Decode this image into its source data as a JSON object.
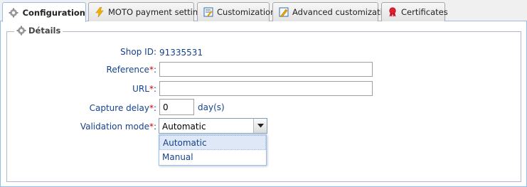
{
  "tabs": [
    {
      "label": "Configuration",
      "icon": "gear-icon",
      "active": true
    },
    {
      "label": "MOTO payment settings",
      "icon": "lightning-icon",
      "active": false
    },
    {
      "label": "Customization",
      "icon": "edit-page-icon",
      "active": false
    },
    {
      "label": "Advanced customization",
      "icon": "pencil-page-icon",
      "active": false
    },
    {
      "label": "Certificates",
      "icon": "certificate-ribbon-icon",
      "active": false
    }
  ],
  "section": {
    "title": "Détails"
  },
  "form": {
    "shop_id_label": "Shop ID:",
    "shop_id_value": "91335531",
    "reference_label": "Reference",
    "reference_value": "",
    "url_label": "URL",
    "url_value": "",
    "capture_delay_label": "Capture delay",
    "capture_delay_value": "0",
    "capture_delay_unit": "day(s)",
    "validation_mode_label": "Validation mode",
    "validation_mode_value": "Automatic",
    "required_marker": "*",
    "colon": ":"
  },
  "dropdown": {
    "options": [
      "Automatic",
      "Manual"
    ],
    "selected": "Automatic"
  },
  "colors": {
    "label": "#15428b",
    "required": "#cc0000",
    "border": "#99bbe8"
  }
}
